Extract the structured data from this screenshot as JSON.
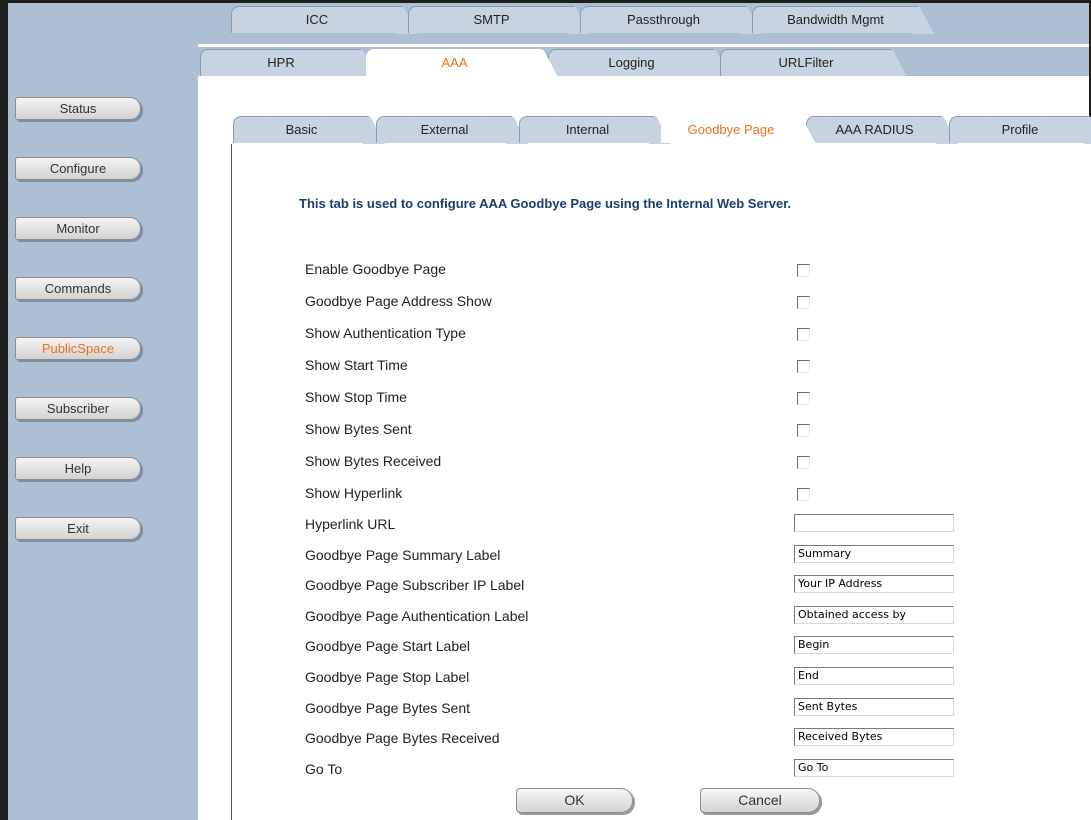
{
  "sidebar": {
    "items": [
      {
        "label": "Status"
      },
      {
        "label": "Configure"
      },
      {
        "label": "Monitor"
      },
      {
        "label": "Commands"
      },
      {
        "label": "PublicSpace",
        "active": true
      },
      {
        "label": "Subscriber"
      },
      {
        "label": "Help"
      },
      {
        "label": "Exit"
      }
    ]
  },
  "top_tabs_row1": [
    {
      "label": "ICC"
    },
    {
      "label": "SMTP"
    },
    {
      "label": "Passthrough"
    },
    {
      "label": "Bandwidth Mgmt"
    }
  ],
  "top_tabs_row2": [
    {
      "label": "HPR"
    },
    {
      "label": "AAA",
      "active": true
    },
    {
      "label": "Logging"
    },
    {
      "label": "URLFilter"
    }
  ],
  "sub_tabs": [
    {
      "label": "Basic"
    },
    {
      "label": "External"
    },
    {
      "label": "Internal"
    },
    {
      "label": "Goodbye Page",
      "active": true
    },
    {
      "label": "AAA RADIUS"
    },
    {
      "label": "Profile"
    }
  ],
  "intro_text": "This tab is used to configure AAA Goodbye Page using the Internal Web Server.",
  "checkbox_rows": [
    {
      "label": "Enable Goodbye Page",
      "checked": false
    },
    {
      "label": "Goodbye Page Address Show",
      "checked": false
    },
    {
      "label": "Show Authentication Type",
      "checked": false
    },
    {
      "label": "Show Start Time",
      "checked": false
    },
    {
      "label": "Show Stop Time",
      "checked": false
    },
    {
      "label": "Show Bytes Sent",
      "checked": false
    },
    {
      "label": "Show Bytes Received",
      "checked": false
    },
    {
      "label": "Show Hyperlink",
      "checked": false
    }
  ],
  "text_rows": [
    {
      "label": "Hyperlink URL",
      "value": ""
    },
    {
      "label": "Goodbye Page Summary Label",
      "value": "Summary"
    },
    {
      "label": "Goodbye Page Subscriber IP Label",
      "value": "Your IP Address"
    },
    {
      "label": "Goodbye Page Authentication Label",
      "value": "Obtained access by"
    },
    {
      "label": "Goodbye Page Start Label",
      "value": "Begin"
    },
    {
      "label": "Goodbye Page Stop Label",
      "value": "End"
    },
    {
      "label": "Goodbye Page Bytes Sent",
      "value": "Sent Bytes"
    },
    {
      "label": "Goodbye Page Bytes Received",
      "value": "Received Bytes"
    },
    {
      "label": "Go To",
      "value": "Go To"
    }
  ],
  "buttons": {
    "ok": "OK",
    "cancel": "Cancel"
  },
  "colors": {
    "sidebar_bg": "#aebfd4",
    "tab_bg": "#c7d3e1",
    "active_text": "#e8731c",
    "intro_text": "#1a3f6a"
  }
}
